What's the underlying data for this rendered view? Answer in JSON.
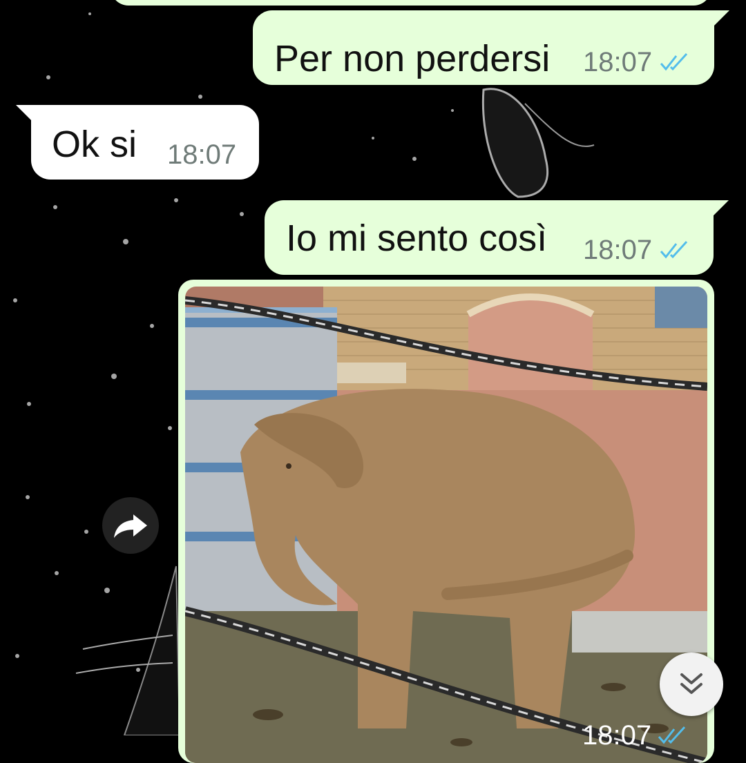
{
  "messages": [
    {
      "text": "Per non perdersi",
      "time": "18:07",
      "status_icon": "double-check-blue"
    },
    {
      "text": "Ok si",
      "time": "18:07"
    },
    {
      "text": "Io mi sento così",
      "time": "18:07",
      "status_icon": "double-check-blue"
    }
  ],
  "image_message": {
    "description_icon": "elephant-photo",
    "time": "18:07",
    "status_icon": "double-check-blue"
  },
  "buttons": {
    "forward_icon": "share-forward-icon",
    "scroll_down_icon": "double-chevron-down-icon"
  },
  "colors": {
    "outgoing_bubble": "#e6ffda",
    "incoming_bubble": "#ffffff",
    "tick_blue": "#53bdeb",
    "time_gray": "#6f7b78"
  }
}
